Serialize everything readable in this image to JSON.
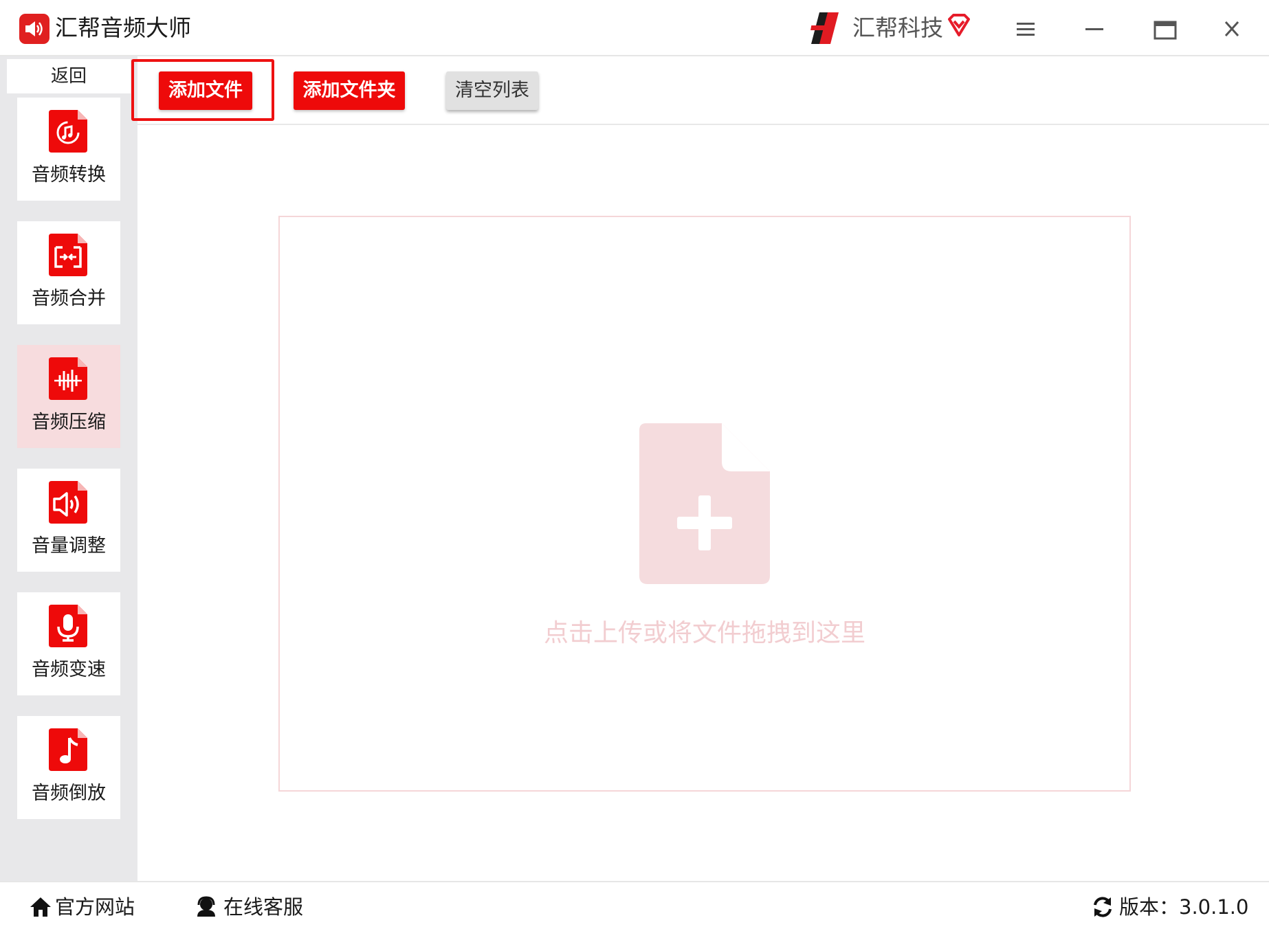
{
  "window": {
    "title": "汇帮音频大师",
    "brand_name": "汇帮科技"
  },
  "sidebar": {
    "back_label": "返回",
    "items": [
      {
        "label": "音频转换",
        "icon": "audio-convert-icon",
        "active": false
      },
      {
        "label": "音频合并",
        "icon": "audio-merge-icon",
        "active": false
      },
      {
        "label": "音频压缩",
        "icon": "audio-compress-icon",
        "active": true
      },
      {
        "label": "音量调整",
        "icon": "volume-adjust-icon",
        "active": false
      },
      {
        "label": "音频变速",
        "icon": "microphone-icon",
        "active": false
      },
      {
        "label": "音频倒放",
        "icon": "music-note-icon",
        "active": false
      }
    ]
  },
  "toolbar": {
    "add_file_label": "添加文件",
    "add_folder_label": "添加文件夹",
    "clear_list_label": "清空列表"
  },
  "dropzone": {
    "hint": "点击上传或将文件拖拽到这里",
    "icon": "file-add-icon"
  },
  "footer": {
    "website_label": "官方网站",
    "support_label": "在线客服",
    "version_label": "版本：3.0.1.0"
  },
  "colors": {
    "accent": "#ee0a0a",
    "active_nav_bg": "#f7dcde",
    "sidebar_bg": "#e8e8ea",
    "dropzone_tint": "#f5dcde"
  }
}
